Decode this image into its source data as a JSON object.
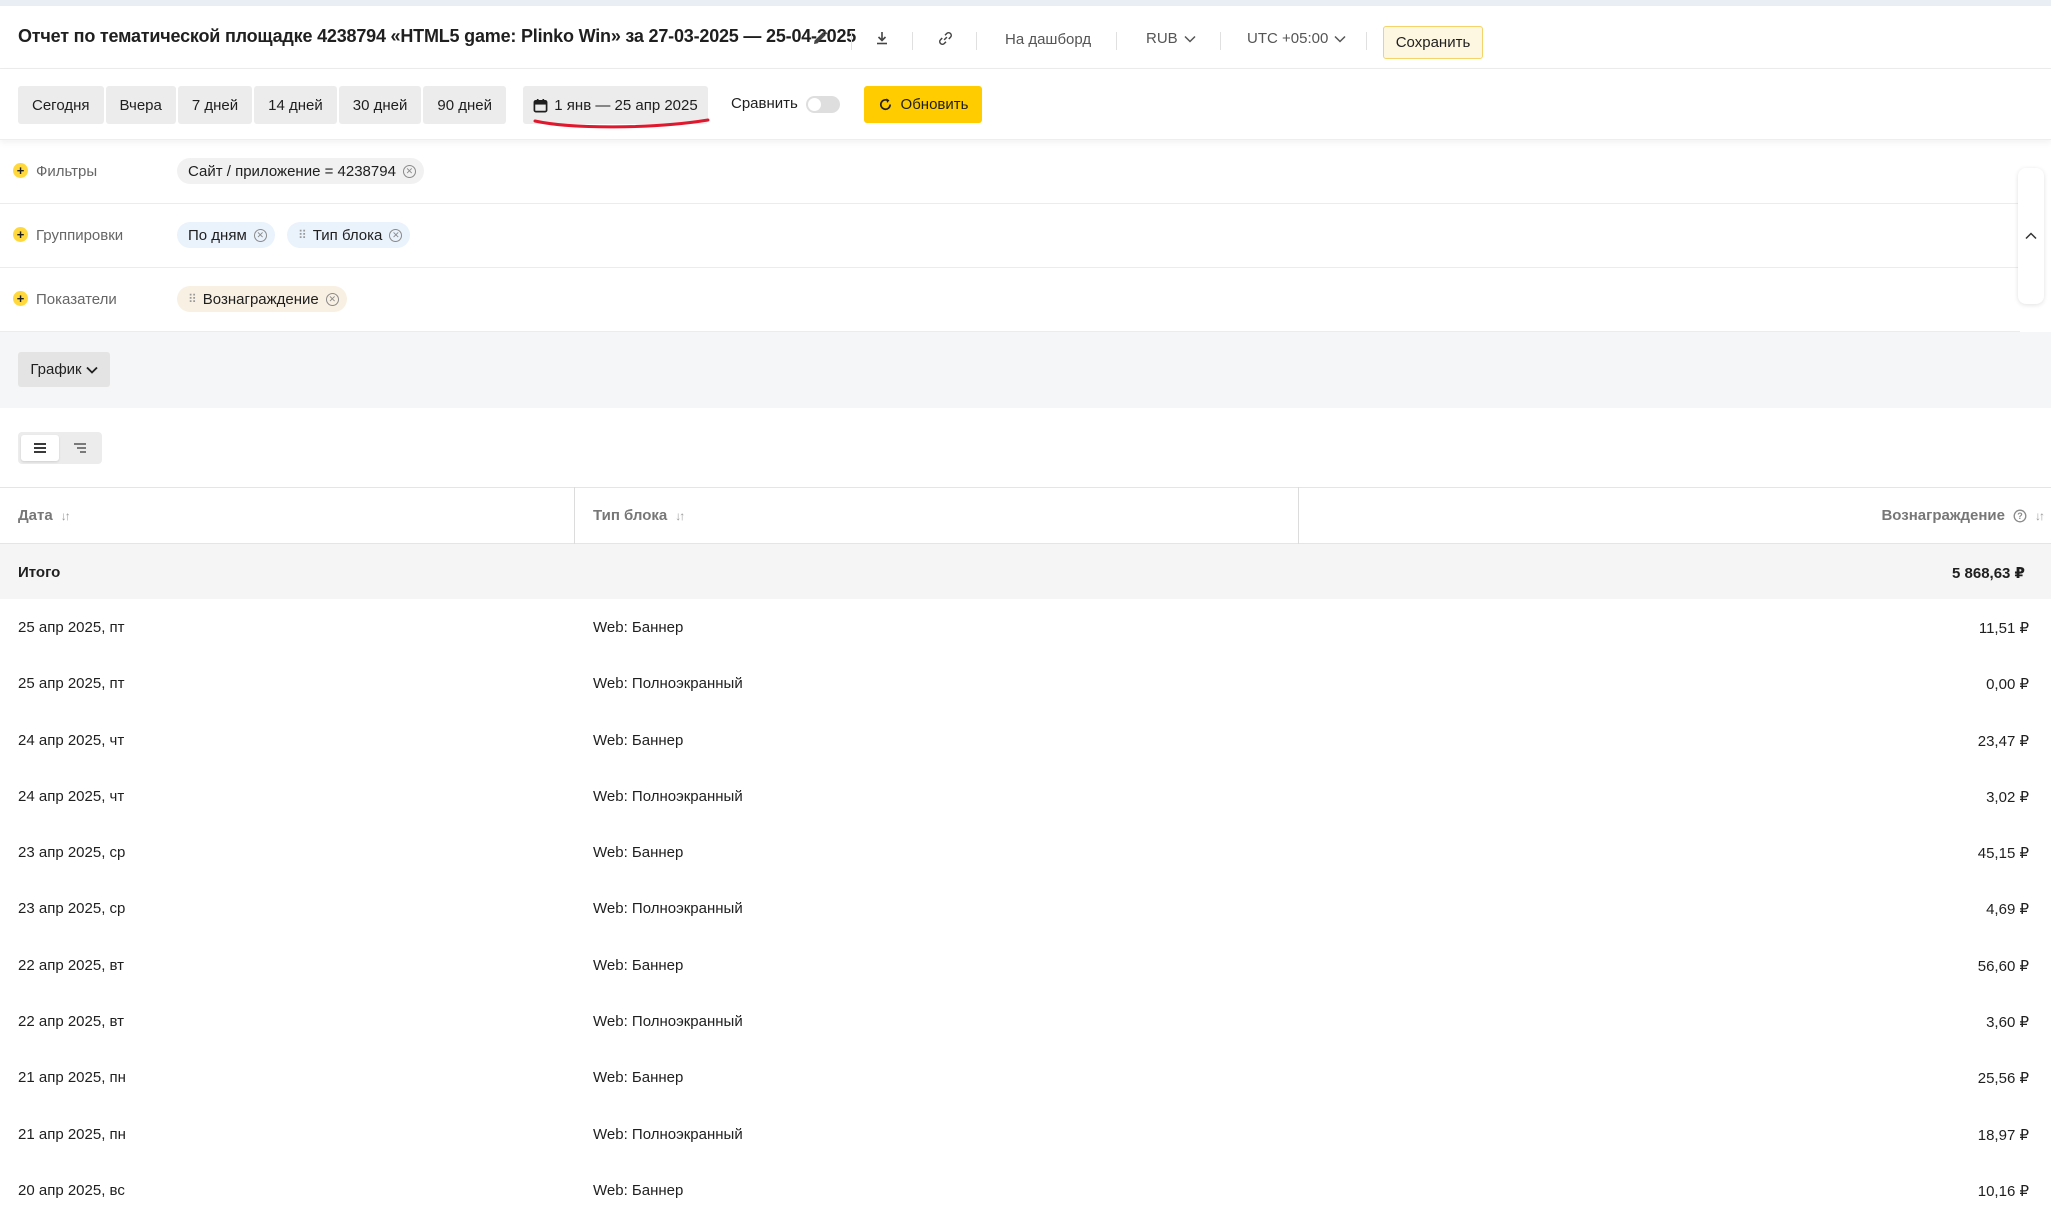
{
  "header": {
    "title": "Отчет по тематической площадке 4238794 «HTML5 game: Plinko Win» за 27-03-2025 — 25-04-2025",
    "dashboard_link": "На дашборд",
    "currency": "RUB",
    "timezone": "UTC +05:00",
    "save_label": "Сохранить",
    "icons": [
      "pencil-icon",
      "download-icon",
      "link-icon",
      "chevron-down-icon"
    ]
  },
  "period": {
    "presets": [
      "Сегодня",
      "Вчера",
      "7 дней",
      "14 дней",
      "30 дней",
      "90 дней"
    ],
    "date_range": "1 янв — 25 апр 2025",
    "compare_label": "Сравнить",
    "compare_enabled": false,
    "refresh_label": "Обновить"
  },
  "filters": {
    "label": "Фильтры",
    "chips": [
      "Сайт / приложение = 4238794"
    ]
  },
  "groupings": {
    "label": "Группировки",
    "chips": [
      "По дням",
      "Тип блока"
    ]
  },
  "metrics": {
    "label": "Показатели",
    "chips": [
      "Вознаграждение"
    ]
  },
  "graph": {
    "button_label": "График"
  },
  "table": {
    "columns": [
      "Дата",
      "Тип блока",
      "Вознаграждение"
    ],
    "total_label": "Итого",
    "total_value": "5 868,63 ₽",
    "rows": [
      [
        "25 апр 2025, пт",
        "Web: Баннер",
        "11,51 ₽"
      ],
      [
        "25 апр 2025, пт",
        "Web: Полноэкранный",
        "0,00 ₽"
      ],
      [
        "24 апр 2025, чт",
        "Web: Баннер",
        "23,47 ₽"
      ],
      [
        "24 апр 2025, чт",
        "Web: Полноэкранный",
        "3,02 ₽"
      ],
      [
        "23 апр 2025, ср",
        "Web: Баннер",
        "45,15 ₽"
      ],
      [
        "23 апр 2025, ср",
        "Web: Полноэкранный",
        "4,69 ₽"
      ],
      [
        "22 апр 2025, вт",
        "Web: Баннер",
        "56,60 ₽"
      ],
      [
        "22 апр 2025, вт",
        "Web: Полноэкранный",
        "3,60 ₽"
      ],
      [
        "21 апр 2025, пн",
        "Web: Баннер",
        "25,56 ₽"
      ],
      [
        "21 апр 2025, пн",
        "Web: Полноэкранный",
        "18,97 ₽"
      ],
      [
        "20 апр 2025, вс",
        "Web: Баннер",
        "10,16 ₽"
      ]
    ]
  },
  "colors": {
    "accent_yellow": "#ffcc00",
    "annotation_red": "#e0182d",
    "chip_blue": "#eaf2fc",
    "chip_beige": "#f8f0e3"
  }
}
